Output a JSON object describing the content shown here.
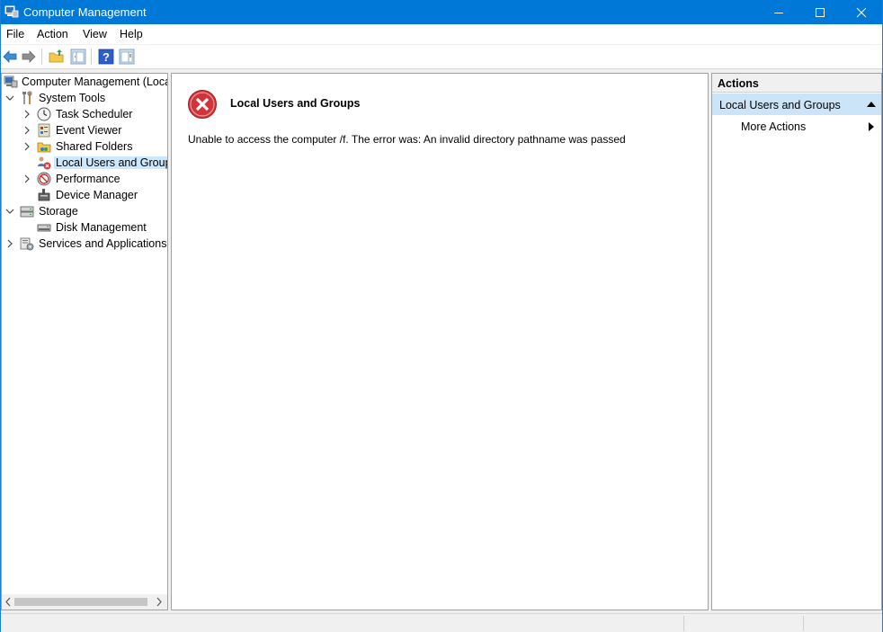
{
  "window": {
    "title": "Computer Management",
    "accent_color": "#0078d7",
    "controls": [
      "minimize-icon",
      "maximize-icon",
      "close-icon"
    ]
  },
  "menu": {
    "items": [
      "File",
      "Action",
      "View",
      "Help"
    ]
  },
  "toolbar": {
    "buttons": [
      "back-arrow-icon",
      "forward-arrow-icon",
      "up-folder-icon",
      "show-hide-console-tree-icon",
      "help-icon",
      "show-hide-action-pane-icon"
    ]
  },
  "tree": {
    "root": "Computer Management (Local",
    "items": [
      {
        "label": "System Tools",
        "icon": "system-tools-icon",
        "expanded": true
      },
      {
        "label": "Task Scheduler",
        "icon": "clock-icon"
      },
      {
        "label": "Event Viewer",
        "icon": "event-viewer-icon"
      },
      {
        "label": "Shared Folders",
        "icon": "shared-folder-icon"
      },
      {
        "label": "Local Users and Groups",
        "icon": "users-error-icon",
        "selected": true
      },
      {
        "label": "Performance",
        "icon": "performance-icon"
      },
      {
        "label": "Device Manager",
        "icon": "device-manager-icon"
      },
      {
        "label": "Storage",
        "icon": "storage-icon",
        "expanded": true
      },
      {
        "label": "Disk Management",
        "icon": "disk-icon"
      },
      {
        "label": "Services and Applications",
        "icon": "services-icon"
      }
    ]
  },
  "content": {
    "title": "Local Users and Groups",
    "message": "Unable to access the computer /f. The error was: An invalid directory pathname was passed",
    "error_color": "#d13438"
  },
  "actions": {
    "header": "Actions",
    "section": "Local Users and Groups",
    "items": [
      "More Actions"
    ]
  }
}
